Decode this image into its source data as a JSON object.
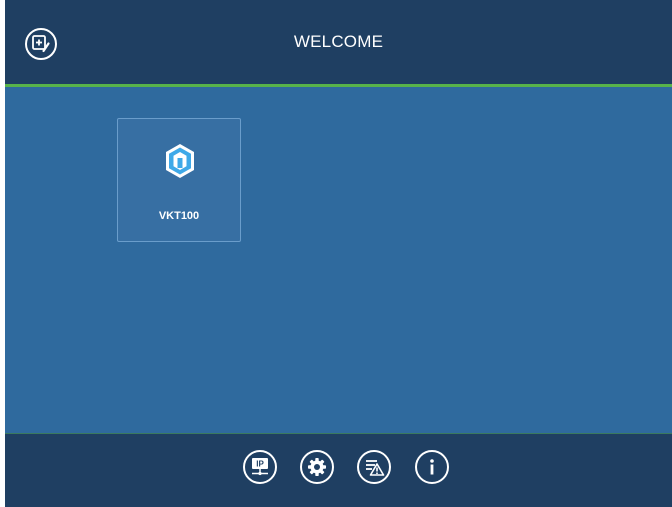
{
  "header": {
    "title": "WELCOME",
    "add_icon": "add-device-icon"
  },
  "devices": [
    {
      "name": "VKT100",
      "icon": "device-hexagon-icon"
    }
  ],
  "footer": {
    "buttons": [
      {
        "icon": "ip-config-icon",
        "text": "IP"
      },
      {
        "icon": "gear-icon"
      },
      {
        "icon": "alarm-list-icon"
      },
      {
        "icon": "info-icon"
      }
    ]
  },
  "colors": {
    "header_bg": "#1f3f62",
    "content_bg": "#2f6a9e",
    "accent_line": "#58b34a",
    "card_border": "#6a9dcb",
    "icon_blue": "#3fa9e8"
  }
}
